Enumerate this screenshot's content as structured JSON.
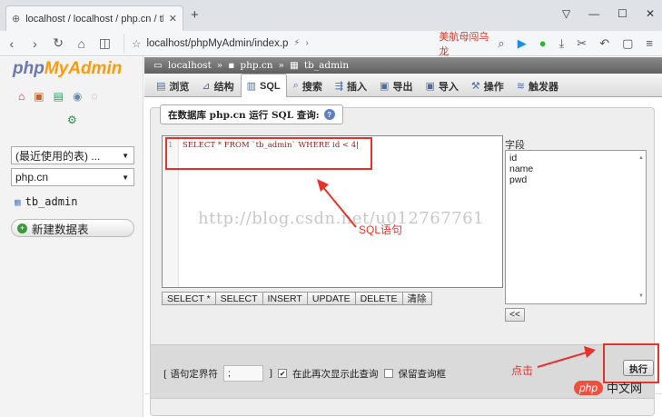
{
  "browser": {
    "tab_title": "localhost / localhost / php.cn / tb",
    "new_tab": "+",
    "url": "localhost/phpMyAdmin/index.p",
    "bookmark": "美航母闯乌龙",
    "window_controls": [
      "▽",
      "—",
      "☐",
      "✕"
    ]
  },
  "sidebar": {
    "logo_part1": "php",
    "logo_part2": "MyAdmin",
    "recent_select": "(最近使用的表) ...",
    "db_select": "php.cn",
    "table_item": "tb_admin",
    "new_table": "新建数据表"
  },
  "breadcrumb": {
    "server": "localhost",
    "database": "php.cn",
    "table": "tb_admin",
    "sep": "»"
  },
  "tabs": [
    {
      "label": "浏览",
      "icon": "browse-icon"
    },
    {
      "label": "结构",
      "icon": "structure-icon"
    },
    {
      "label": "SQL",
      "icon": "sql-icon"
    },
    {
      "label": "搜索",
      "icon": "search-icon"
    },
    {
      "label": "插入",
      "icon": "insert-icon"
    },
    {
      "label": "导出",
      "icon": "export-icon"
    },
    {
      "label": "导入",
      "icon": "import-icon"
    },
    {
      "label": "操作",
      "icon": "operations-icon"
    },
    {
      "label": "触发器",
      "icon": "triggers-icon"
    }
  ],
  "query_box": {
    "legend": "在数据库 php.cn 运行 SQL 查询:",
    "line_number": "1",
    "sql": "SELECT * FROM `tb_admin` WHERE id < 4",
    "fields_label": "字段",
    "fields": [
      "id",
      "name",
      "pwd"
    ],
    "insert_button": "<<",
    "sql_buttons": [
      "SELECT *",
      "SELECT",
      "INSERT",
      "UPDATE",
      "DELETE",
      "清除"
    ]
  },
  "bottom": {
    "delimiter_label_open": "[ 语句定界符",
    "delimiter_value": ";",
    "delimiter_label_close": "]",
    "show_again_label": "在此再次显示此查询",
    "show_again_checked": true,
    "keep_box_label": "保留查询框",
    "keep_box_checked": false,
    "run_button": "执行"
  },
  "annotations": {
    "sql_note": "SQL语句",
    "click_note": "点击",
    "color": "#e8312b"
  },
  "watermark": "http://blog.csdn.net/u012767761",
  "site_logo": {
    "php": "php",
    "cn": "中文网"
  }
}
